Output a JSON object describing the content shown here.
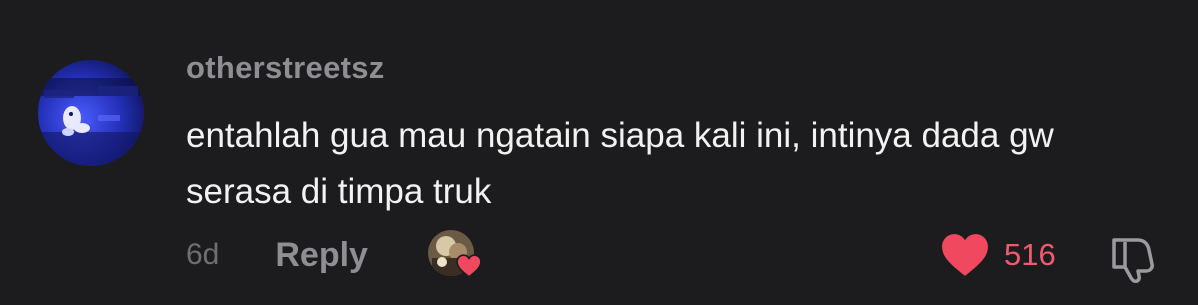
{
  "comment": {
    "username": "otherstreetsz",
    "text": "entahlah gua mau ngatain siapa kali ini, intinya dada gw serasa di timpa truk",
    "timestamp": "6d",
    "reply_label": "Reply",
    "like_count": "516",
    "liked": true,
    "liked_by_creator": true,
    "icons": {
      "avatar": "user-avatar",
      "creator_avatar": "creator-avatar",
      "creator_heart": "heart-icon",
      "like": "heart-icon",
      "dislike": "thumbs-down-icon"
    }
  },
  "colors": {
    "background": "#1c1c1e",
    "username": "#8e8e93",
    "text": "#f2f2f2",
    "muted": "#6e6e73",
    "like_red": "#f0495f"
  }
}
